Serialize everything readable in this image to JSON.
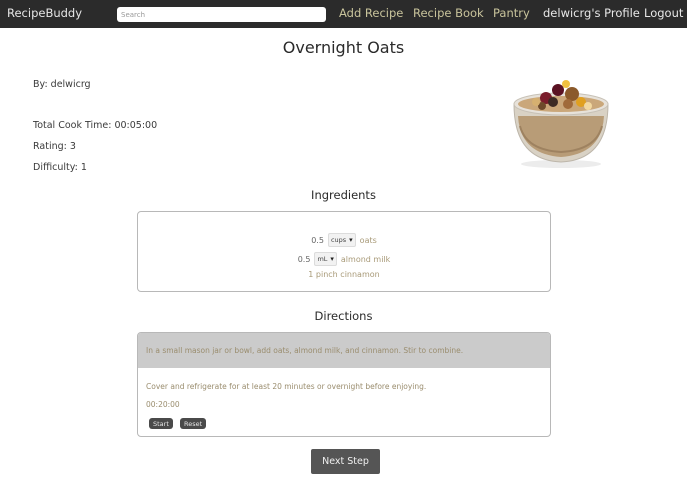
{
  "navbar": {
    "brand": "RecipeBuddy",
    "search_placeholder": "Search",
    "links": {
      "add_recipe": "Add Recipe",
      "recipe_book": "Recipe Book",
      "pantry": "Pantry",
      "profile": "delwicrg's Profile",
      "logout": "Logout"
    },
    "colors": {
      "background": "#2b2b2b",
      "muted_link": "#c9c49c"
    }
  },
  "recipe": {
    "title": "Overnight Oats",
    "author": "By: delwicrg",
    "total_cook_time": "Total Cook Time: 00:05:00",
    "rating": "Rating: 3",
    "difficulty": "Difficulty: 1",
    "image_alt": "overnight oats in glass jar"
  },
  "ingredients": {
    "heading": "Ingredients",
    "items": [
      {
        "amount": "0.5",
        "unit": "cups",
        "name": "oats"
      },
      {
        "amount": "0.5",
        "unit": "mL",
        "name": "almond milk"
      },
      {
        "text": "1 pinch cinnamon"
      }
    ]
  },
  "directions": {
    "heading": "Directions",
    "steps": [
      "In a small mason jar or bowl, add oats, almond milk, and cinnamon. Stir to combine.",
      "Cover and refrigerate for at least 20 minutes or overnight before enjoying."
    ],
    "timer": "00:20:00",
    "start_label": "Start",
    "reset_label": "Reset"
  },
  "next_step_label": "Next Step"
}
